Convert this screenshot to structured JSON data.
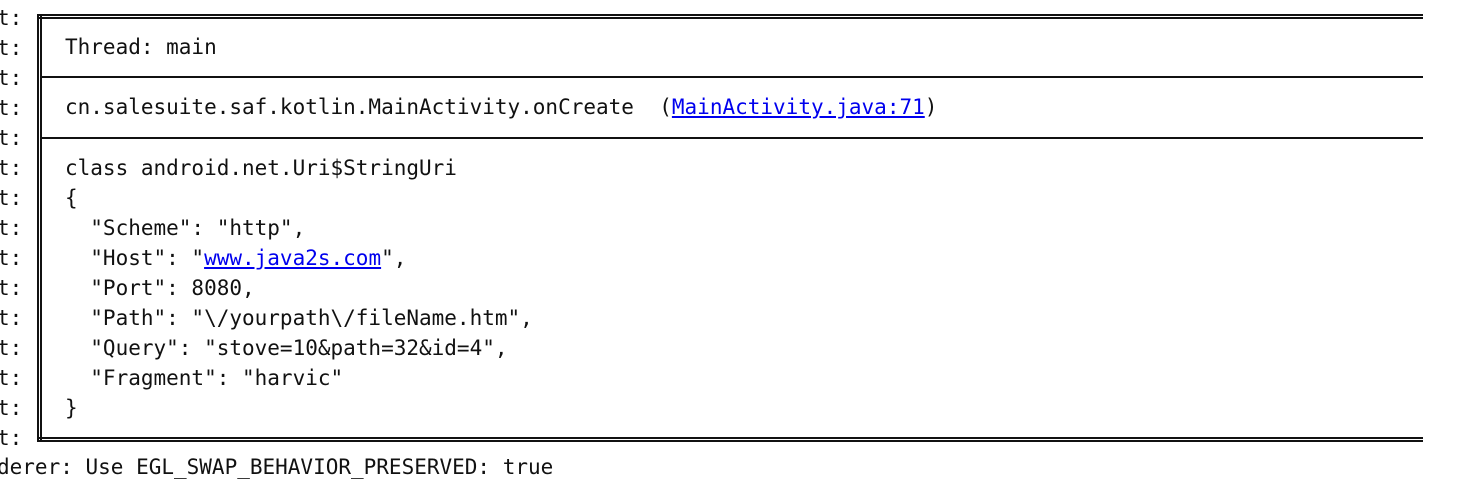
{
  "gutter_label": "t:",
  "thread": {
    "label": "Thread: main"
  },
  "stack": {
    "method": "cn.salesuite.saf.kotlin.MainActivity.onCreate  ",
    "open_paren": "(",
    "link": "MainActivity.java:71",
    "close_paren": ")"
  },
  "payload": {
    "class_line": "class android.net.Uri$StringUri",
    "open_brace": "{",
    "scheme_line": "  \"Scheme\": \"http\",",
    "host_prefix": "  \"Host\": \"",
    "host_link": "www.java2s.com",
    "host_suffix": "\",",
    "port_line": "  \"Port\": 8080,",
    "path_line": "  \"Path\": \"\\/yourpath\\/fileName.htm\",",
    "query_line": "  \"Query\": \"stove=10&path=32&id=4\",",
    "fragment_line": "  \"Fragment\": \"harvic\"",
    "close_brace": "}"
  },
  "bottom_text": "derer: Use EGL_SWAP_BEHAVIOR_PRESERVED: true"
}
